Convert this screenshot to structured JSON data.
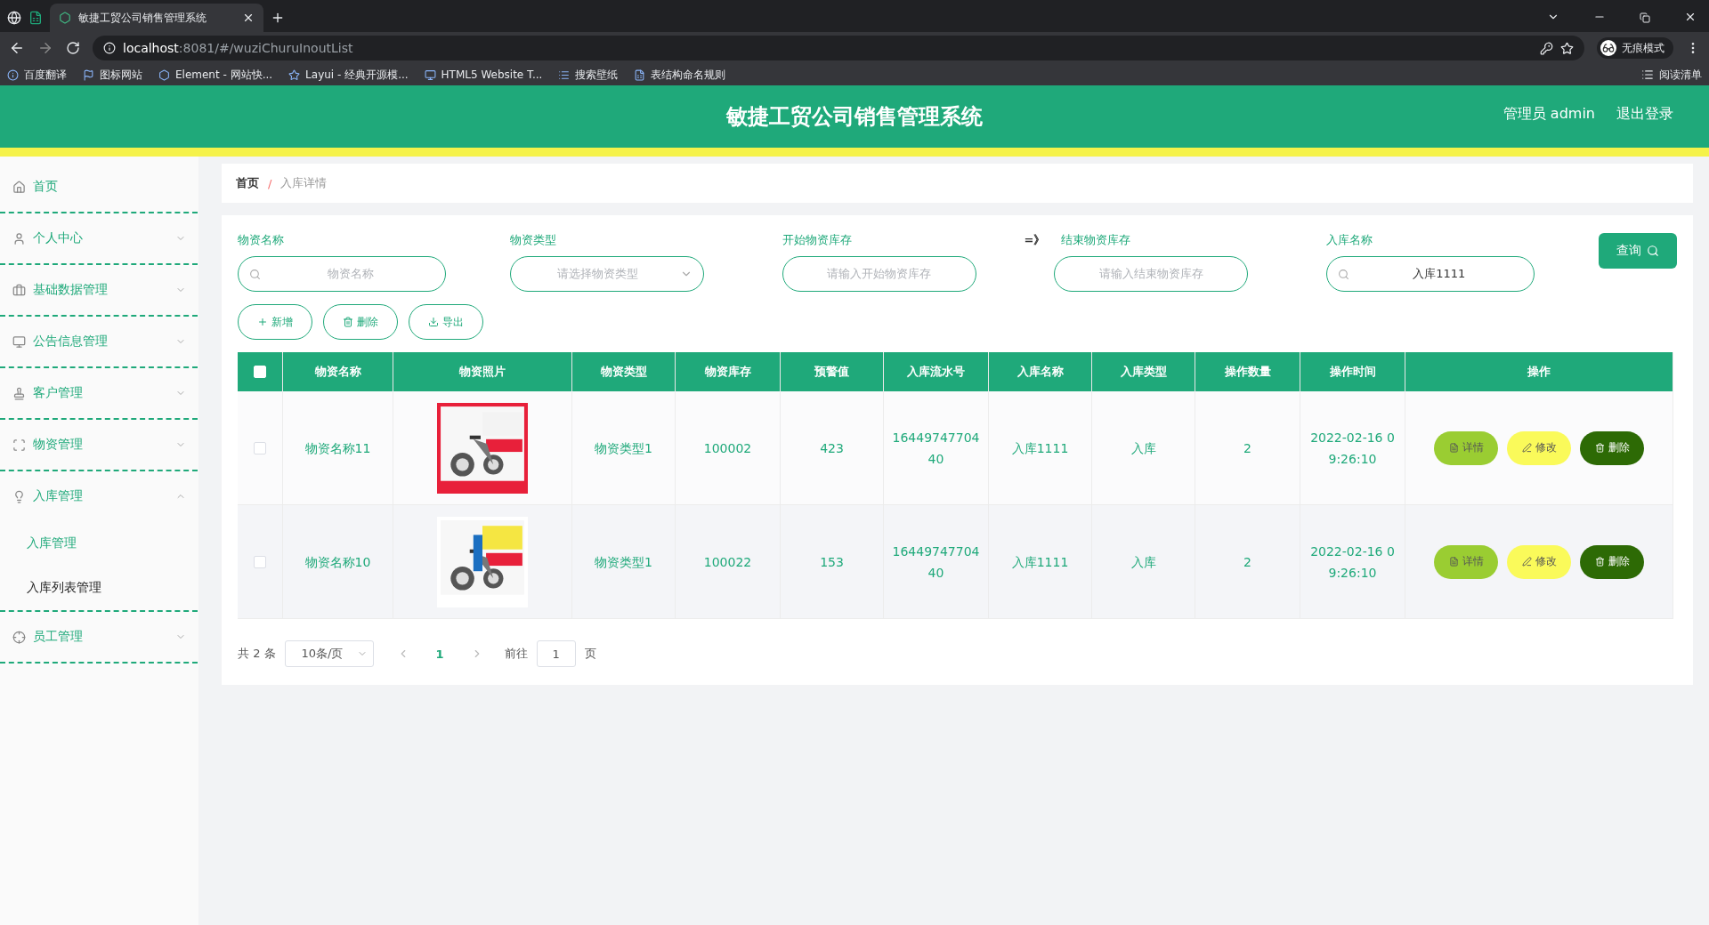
{
  "browser": {
    "tab_title": "敏捷工贸公司销售管理系统",
    "url_host": "localhost",
    "url_path": ":8081/#/wuziChuruInoutList",
    "profile": "无痕模式",
    "bookmarks": [
      "百度翻译",
      "图标网站",
      "Element - 网站快...",
      "Layui - 经典开源模...",
      "HTML5 Website T...",
      "搜索壁纸",
      "表结构命名规则"
    ],
    "reading_list": "阅读清单"
  },
  "header": {
    "title": "敏捷工贸公司销售管理系统",
    "user": "管理员 admin",
    "logout": "退出登录"
  },
  "sidebar": {
    "items": [
      {
        "label": "首页",
        "kind": "link"
      },
      {
        "label": "个人中心",
        "kind": "menu",
        "expanded": false
      },
      {
        "label": "基础数据管理",
        "kind": "menu",
        "expanded": false
      },
      {
        "label": "公告信息管理",
        "kind": "menu",
        "expanded": false
      },
      {
        "label": "客户管理",
        "kind": "menu",
        "expanded": false
      },
      {
        "label": "物资管理",
        "kind": "menu",
        "expanded": false
      },
      {
        "label": "入库管理",
        "kind": "menu",
        "expanded": true,
        "children": [
          {
            "label": "入库管理",
            "selected": true
          },
          {
            "label": "入库列表管理",
            "selected": false
          }
        ]
      },
      {
        "label": "员工管理",
        "kind": "menu",
        "expanded": false
      }
    ]
  },
  "breadcrumb": {
    "items": [
      "首页",
      "入库详情"
    ],
    "separator": "/"
  },
  "filters": {
    "fields": [
      {
        "label": "物资名称",
        "kind": "search",
        "placeholder": "物资名称"
      },
      {
        "label": "物资类型",
        "kind": "select",
        "placeholder": "请选择物资类型"
      },
      {
        "label": "开始物资库存",
        "kind": "plain",
        "placeholder": "请输入开始物资库存"
      },
      {
        "label": "结束物资库存",
        "kind": "plain",
        "placeholder": "请输入结束物资库存",
        "prefix": "=》"
      },
      {
        "label": "入库名称",
        "kind": "search",
        "value": "入库1111"
      }
    ],
    "query_button": "查询"
  },
  "actions": [
    {
      "label": "新增",
      "kind": "add"
    },
    {
      "label": "删除",
      "kind": "delete"
    },
    {
      "label": "导出",
      "kind": "export"
    }
  ],
  "table": {
    "header_checked": false,
    "columns": [
      "物资名称",
      "物资照片",
      "物资类型",
      "物资库存",
      "预警值",
      "入库流水号",
      "入库名称",
      "入库类型",
      "操作数量",
      "操作时间",
      "操作"
    ],
    "rows": [
      {
        "checked": false,
        "name": "物资名称11",
        "type": "物资类型1",
        "stock": "100002",
        "warning": "423",
        "serial": "16449747704 40",
        "inbound_name": "入库1111",
        "inbound_type": "入库",
        "quantity": "2",
        "time": "2022-02-16 0 9:26:10",
        "buttons": [
          {
            "label": "详情",
            "kind": "detail"
          },
          {
            "label": "修改",
            "kind": "edit"
          },
          {
            "label": "删除",
            "kind": "delete"
          }
        ]
      },
      {
        "checked": false,
        "name": "物资名称10",
        "type": "物资类型1",
        "stock": "100022",
        "warning": "153",
        "serial": "16449747704 40",
        "inbound_name": "入库1111",
        "inbound_type": "入库",
        "quantity": "2",
        "time": "2022-02-16 0 9:26:10",
        "buttons": [
          {
            "label": "详情",
            "kind": "detail"
          },
          {
            "label": "修改",
            "kind": "edit"
          },
          {
            "label": "删除",
            "kind": "delete"
          }
        ]
      }
    ]
  },
  "pagination": {
    "total": "共 2 条",
    "page_size": "10条/页",
    "pages": [
      {
        "label": "1",
        "selected": true
      }
    ],
    "goto_label": "前往",
    "goto_value": "1",
    "goto_suffix": "页"
  }
}
